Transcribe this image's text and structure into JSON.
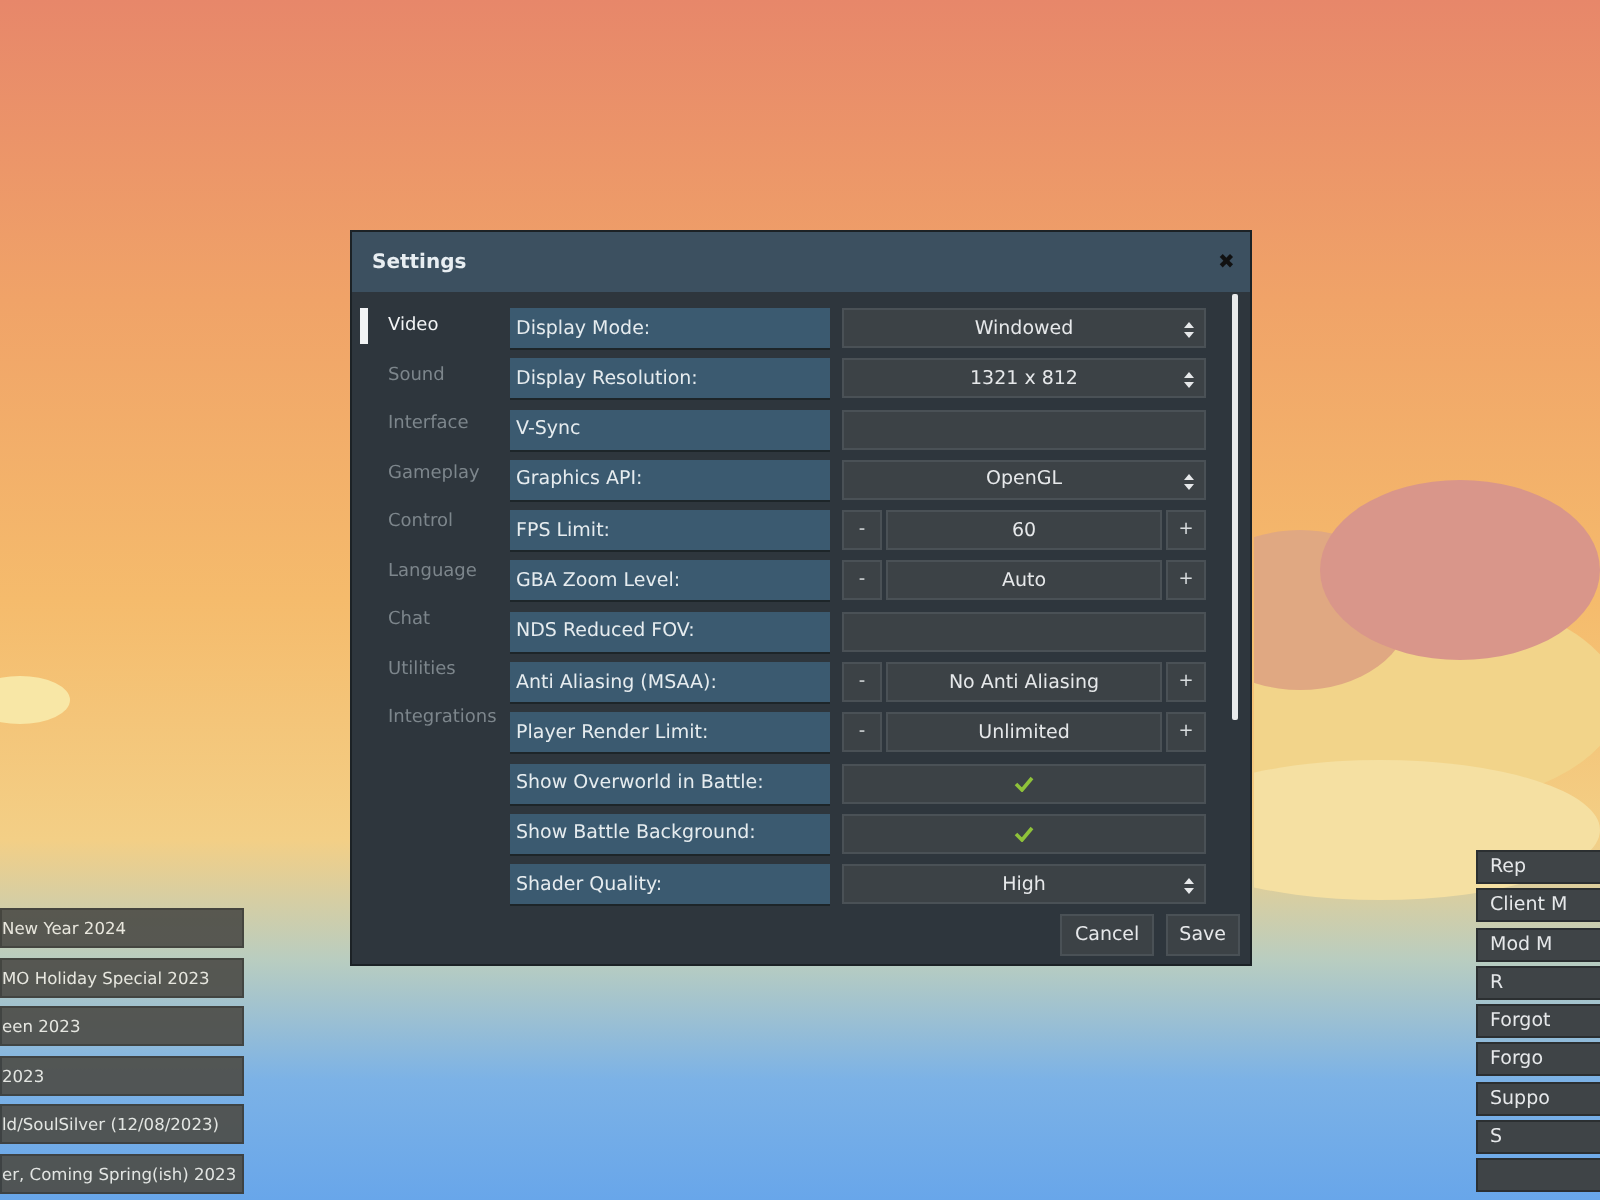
{
  "dialog": {
    "title": "Settings",
    "close": "✖",
    "categories": [
      {
        "label": "Video",
        "selected": true
      },
      {
        "label": "Sound",
        "selected": false
      },
      {
        "label": "Interface",
        "selected": false
      },
      {
        "label": "Gameplay",
        "selected": false
      },
      {
        "label": "Control",
        "selected": false
      },
      {
        "label": "Language",
        "selected": false
      },
      {
        "label": "Chat",
        "selected": false
      },
      {
        "label": "Utilities",
        "selected": false
      },
      {
        "label": "Integrations",
        "selected": false
      }
    ],
    "settings": [
      {
        "label": "Display Mode:",
        "kind": "select",
        "value": "Windowed"
      },
      {
        "label": "Display Resolution:",
        "kind": "select",
        "value": "1321 x 812"
      },
      {
        "label": "V-Sync",
        "kind": "toggle",
        "checked": false
      },
      {
        "label": "Graphics API:",
        "kind": "select",
        "value": "OpenGL"
      },
      {
        "label": "FPS Limit:",
        "kind": "stepper",
        "value": "60",
        "minus": "-",
        "plus": "+"
      },
      {
        "label": "GBA Zoom Level:",
        "kind": "stepper",
        "value": "Auto",
        "minus": "-",
        "plus": "+"
      },
      {
        "label": "NDS Reduced FOV:",
        "kind": "toggle",
        "checked": false
      },
      {
        "label": "Anti Aliasing (MSAA):",
        "kind": "stepper",
        "value": "No Anti Aliasing",
        "minus": "-",
        "plus": "+"
      },
      {
        "label": "Player Render Limit:",
        "kind": "stepper",
        "value": "Unlimited",
        "minus": "-",
        "plus": "+"
      },
      {
        "label": "Show Overworld in Battle:",
        "kind": "toggle",
        "checked": true
      },
      {
        "label": "Show Battle Background:",
        "kind": "toggle",
        "checked": true
      },
      {
        "label": "Shader Quality:",
        "kind": "select",
        "value": "High"
      }
    ],
    "buttons": [
      "Cancel",
      "Save"
    ]
  },
  "news": [
    "New Year 2024",
    "MO Holiday Special 2023",
    "een 2023",
    "2023",
    "ld/SoulSilver (12/08/2023)",
    "er, Coming Spring(ish) 2023"
  ],
  "menu": [
    {
      "kind": "labeled",
      "label": "Rep"
    },
    {
      "kind": "labeled",
      "label": "Client M"
    },
    {
      "kind": "labeled",
      "label": "Mod M"
    },
    {
      "kind": "labeled",
      "label": "R"
    },
    {
      "kind": "labeled",
      "label": "Forgot"
    },
    {
      "kind": "labeled",
      "label": "Forgo"
    },
    {
      "kind": "labeled",
      "label": "Suppo"
    },
    {
      "kind": "labeled",
      "label": "S"
    },
    {
      "kind": "blank"
    }
  ]
}
